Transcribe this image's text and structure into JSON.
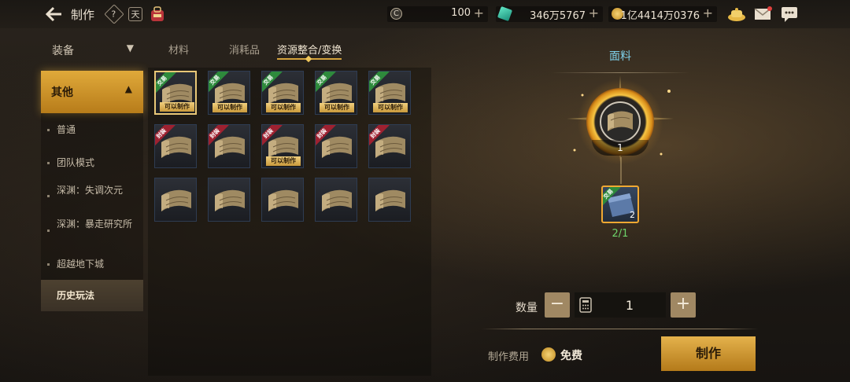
{
  "header": {
    "title": "制作",
    "help_icon_label": "?",
    "calendar_icon_label": "天",
    "currencies": [
      {
        "name": "credit",
        "value": "100"
      },
      {
        "name": "gem",
        "value": "346万5767"
      },
      {
        "name": "gold",
        "value": "1亿4414万0376"
      }
    ]
  },
  "sidebar": {
    "dropdown_label": "装备",
    "category_label": "其他",
    "items": [
      {
        "label": "普通"
      },
      {
        "label": "团队模式"
      },
      {
        "label": "深渊：失调次元"
      },
      {
        "label": "深渊：暴走研究所"
      },
      {
        "label": "超越地下城"
      },
      {
        "label": "历史玩法"
      }
    ],
    "selected_index": 5
  },
  "tabs": [
    {
      "label": "材料"
    },
    {
      "label": "消耗品"
    },
    {
      "label": "资源整合/变换"
    }
  ],
  "active_tab": 2,
  "grid": {
    "badge_text": "可以制作",
    "ribbon_trade": "交易",
    "ribbon_bound": "封装",
    "rows": [
      [
        {
          "ribbon": "g",
          "badge": true
        },
        {
          "ribbon": "g",
          "badge": true
        },
        {
          "ribbon": "g",
          "badge": true
        },
        {
          "ribbon": "g",
          "badge": true
        },
        {
          "ribbon": "g",
          "badge": true
        }
      ],
      [
        {
          "ribbon": "r",
          "badge": false
        },
        {
          "ribbon": "r",
          "badge": false
        },
        {
          "ribbon": "r",
          "badge": true
        },
        {
          "ribbon": "r",
          "badge": false
        },
        {
          "ribbon": "r",
          "badge": false
        }
      ],
      [
        {
          "ribbon": "",
          "badge": false
        },
        {
          "ribbon": "",
          "badge": false
        },
        {
          "ribbon": "",
          "badge": false
        },
        {
          "ribbon": "",
          "badge": false
        },
        {
          "ribbon": "",
          "badge": false
        }
      ]
    ]
  },
  "detail": {
    "item_name": "面料",
    "output_count": "1",
    "material_ribbon": "交易",
    "material_count": "2",
    "material_requirement": "2/1",
    "quantity_label": "数量",
    "quantity_value": "1",
    "fee_label": "制作费用",
    "fee_value": "免费",
    "make_button": "制作"
  },
  "colors": {
    "accent_gold": "#d4a23c",
    "title_cyan": "#7fd2ec",
    "requirement_green": "#6ed36a"
  }
}
